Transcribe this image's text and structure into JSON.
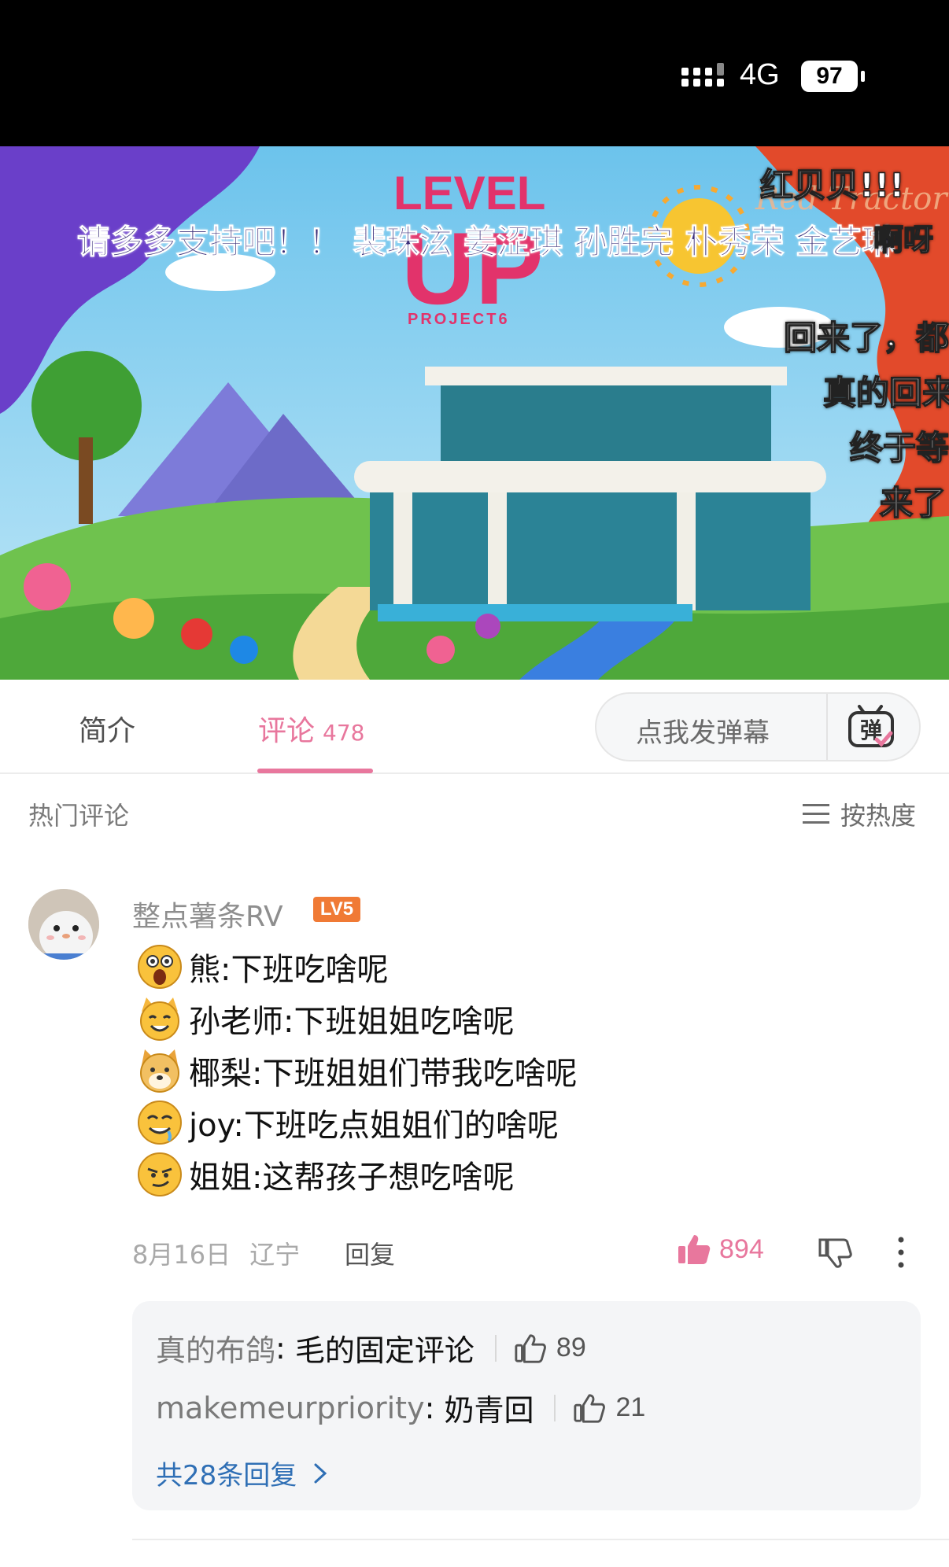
{
  "status_bar": {
    "network": "4G",
    "battery": "97",
    "icons": [
      "signal-icon",
      "battery-icon"
    ]
  },
  "video": {
    "logo_line1": "LEVEL",
    "logo_line2": "UP",
    "logo_line3": "PROJECT6",
    "watermark": "Red Tractor",
    "danmaku": [
      "请多多支持吧！！ 裴珠泫 姜涩琪 孙胜完 朴秀荣 金艺琳",
      "红贝贝!!!",
      "啊呀",
      "回来了，都",
      "真的回来",
      "终于等",
      "来了"
    ]
  },
  "tabs": {
    "intro": "简介",
    "comments": "评论",
    "comments_count": "478",
    "danmaku_placeholder": "点我发弹幕",
    "danmaku_toggle_glyph": "弹"
  },
  "comments_header": {
    "title": "热门评论",
    "sort": "按热度"
  },
  "comment": {
    "user": "整点薯条RV",
    "level": "LV5",
    "lines": [
      {
        "emoji": "surprised-emoji",
        "text": "熊:下班吃啥呢"
      },
      {
        "emoji": "cat-smile-emoji",
        "text": "孙老师:下班姐姐吃啥呢"
      },
      {
        "emoji": "dog-emoji",
        "text": "椰梨:下班姐姐们带我吃啥呢"
      },
      {
        "emoji": "drool-emoji",
        "text": "joy:下班吃点姐姐们的啥呢"
      },
      {
        "emoji": "smirk-emoji",
        "text": "姐姐:这帮孩子想吃啥呢"
      }
    ],
    "date": "8月16日",
    "location": "辽宁",
    "reply_label": "回复",
    "likes": "894",
    "like_color": "#e8779d"
  },
  "replies": [
    {
      "user": "真的布鸽",
      "text": "毛的固定评论",
      "likes": "89"
    },
    {
      "user": "makemeurpriority",
      "text": "奶青回",
      "likes": "21"
    }
  ],
  "replies_total": "共28条回复",
  "colors": {
    "accent": "#e8779d",
    "link": "#2f6fb5",
    "level_badge": "#f07a35"
  }
}
